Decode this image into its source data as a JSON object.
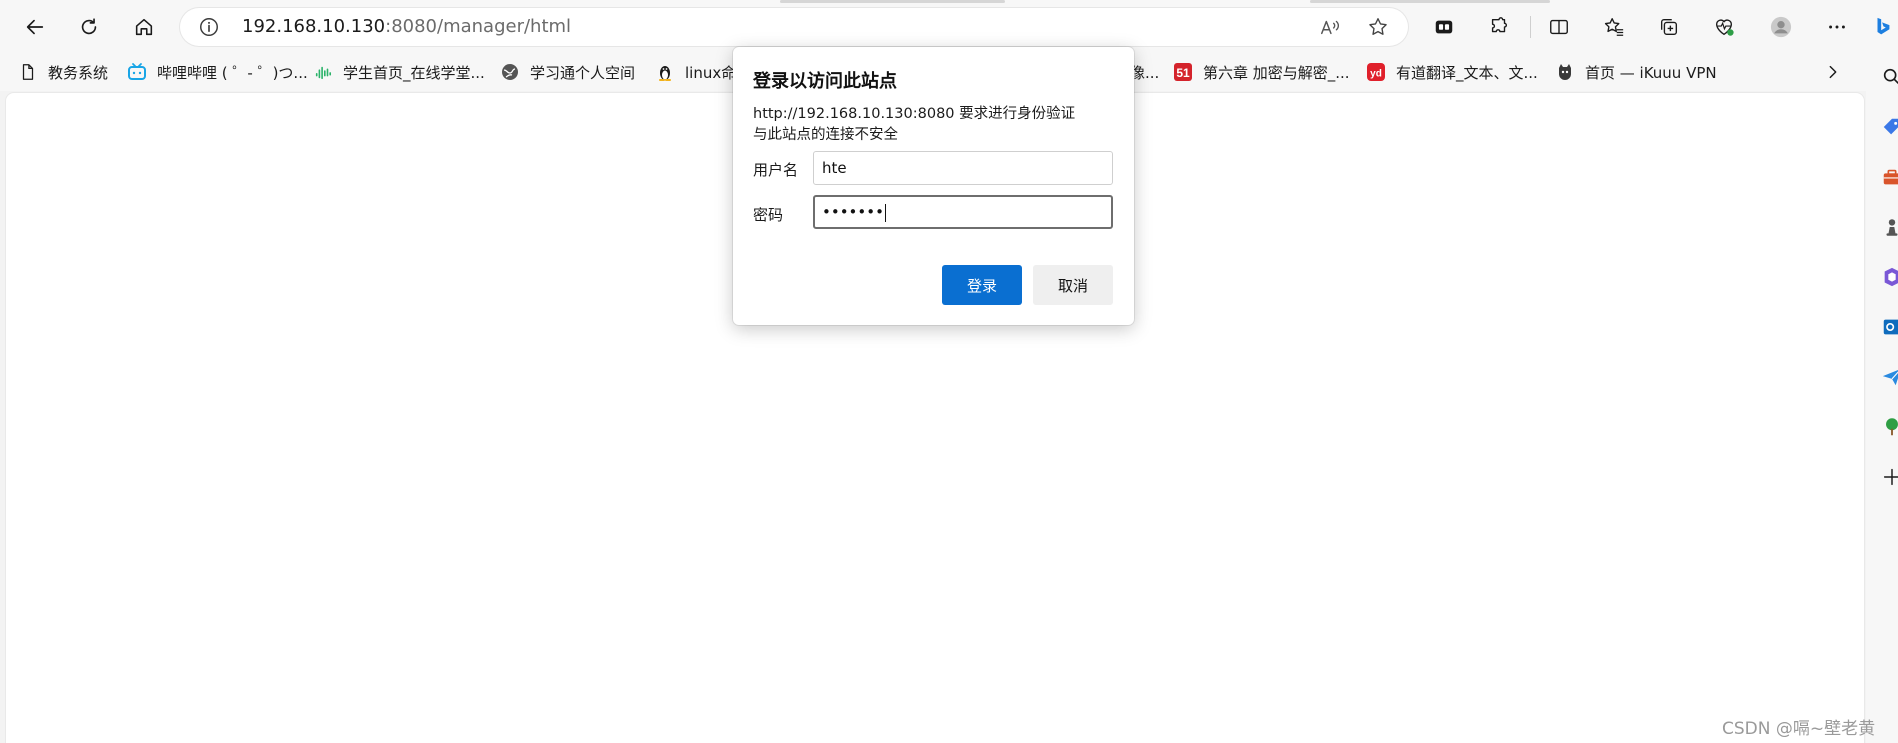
{
  "address_bar": {
    "host": "192.168.10.130",
    "path": ":8080/manager/html"
  },
  "bookmarks": [
    {
      "label": "教务系统",
      "icon": "document-icon"
    },
    {
      "label": "哔哩哔哩 ( ゜- ゜)つ...",
      "icon": "bilibili-icon"
    },
    {
      "label": "学生首页_在线学堂...",
      "icon": "audio-wave-icon"
    },
    {
      "label": "学习通个人空间",
      "icon": "globe-icon"
    },
    {
      "label": "linux命",
      "icon": "penguin-icon"
    },
    {
      "label": "像...",
      "icon": ""
    },
    {
      "label": "第六章 加密与解密_...",
      "icon": "51cto-icon"
    },
    {
      "label": "有道翻译_文本、文...",
      "icon": "youdao-icon"
    },
    {
      "label": "首页 — iKuuu VPN",
      "icon": "cat-icon"
    }
  ],
  "dialog": {
    "title": "登录以访问此站点",
    "message_line1": "http://192.168.10.130:8080 要求进行身份验证",
    "message_line2": "与此站点的连接不安全",
    "username_label": "用户名",
    "username_value": "hte",
    "password_label": "密码",
    "password_value": "•••••••",
    "login_button": "登录",
    "cancel_button": "取消"
  },
  "watermark": "CSDN @嗝~壁老黄",
  "colors": {
    "primary_button": "#0a6fd1",
    "secondary_button": "#efefef"
  }
}
